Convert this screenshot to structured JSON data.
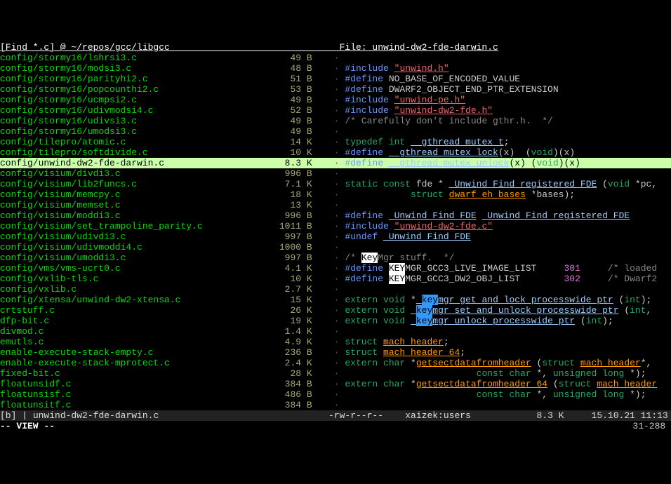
{
  "header": {
    "left": "[Find *.c] @ ~/repos/gcc/libgcc",
    "right": "File: unwind-dw2-fde-darwin.c"
  },
  "files": [
    {
      "n": "config/stormy16/lshrsi3.c",
      "s": "49 B"
    },
    {
      "n": "config/stormy16/modsi3.c",
      "s": "48 B"
    },
    {
      "n": "config/stormy16/parityhi2.c",
      "s": "51 B"
    },
    {
      "n": "config/stormy16/popcounthi2.c",
      "s": "53 B"
    },
    {
      "n": "config/stormy16/ucmpsi2.c",
      "s": "49 B"
    },
    {
      "n": "config/stormy16/udivmodsi4.c",
      "s": "52 B"
    },
    {
      "n": "config/stormy16/udivsi3.c",
      "s": "49 B"
    },
    {
      "n": "config/stormy16/umodsi3.c",
      "s": "49 B"
    },
    {
      "n": "config/tilepro/atomic.c",
      "s": "14 K"
    },
    {
      "n": "config/tilepro/softdivide.c",
      "s": "10 K"
    },
    {
      "n": "config/unwind-dw2-fde-darwin.c",
      "s": "8.3 K",
      "sel": true
    },
    {
      "n": "config/visium/divdi3.c",
      "s": "996 B"
    },
    {
      "n": "config/visium/lib2funcs.c",
      "s": "7.1 K"
    },
    {
      "n": "config/visium/memcpy.c",
      "s": "18 K"
    },
    {
      "n": "config/visium/memset.c",
      "s": "13 K"
    },
    {
      "n": "config/visium/moddi3.c",
      "s": "996 B"
    },
    {
      "n": "config/visium/set_trampoline_parity.c",
      "s": "1011 B"
    },
    {
      "n": "config/visium/udivdi3.c",
      "s": "997 B"
    },
    {
      "n": "config/visium/udivmoddi4.c",
      "s": "1000 B"
    },
    {
      "n": "config/visium/umoddi3.c",
      "s": "997 B"
    },
    {
      "n": "config/vms/vms-ucrt0.c",
      "s": "4.1 K"
    },
    {
      "n": "config/vxlib-tls.c",
      "s": "10 K"
    },
    {
      "n": "config/vxlib.c",
      "s": "2.7 K"
    },
    {
      "n": "config/xtensa/unwind-dw2-xtensa.c",
      "s": "15 K"
    },
    {
      "n": "crtstuff.c",
      "s": "26 K"
    },
    {
      "n": "dfp-bit.c",
      "s": "19 K"
    },
    {
      "n": "divmod.c",
      "s": "1.4 K"
    },
    {
      "n": "emutls.c",
      "s": "4.9 K"
    },
    {
      "n": "enable-execute-stack-empty.c",
      "s": "236 B"
    },
    {
      "n": "enable-execute-stack-mprotect.c",
      "s": "2.4 K"
    },
    {
      "n": "fixed-bit.c",
      "s": "28 K"
    },
    {
      "n": "floatunsidf.c",
      "s": "384 B"
    },
    {
      "n": "floatunsisf.c",
      "s": "486 B"
    },
    {
      "n": "floatunsitf.c",
      "s": "384 B"
    }
  ],
  "status": {
    "tab": "[b] ",
    "file": "unwind-dw2-fde-darwin.c",
    "perm": "-rw-r--r--",
    "owner": "xaizek:users",
    "size": "8.3 K",
    "date": "15.10.21 11:13",
    "mode": "-- VIEW --",
    "pos": "31-288"
  }
}
